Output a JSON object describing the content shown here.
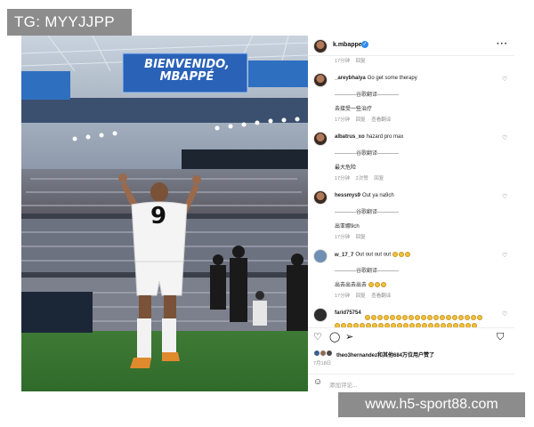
{
  "watermarks": {
    "top_left": "TG: MYYJJPP",
    "bottom_right": "www.h5-sport88.com"
  },
  "photo": {
    "banner_text_line1": "BIENVENIDO,",
    "banner_text_line2": "MBAPPÉ",
    "jersey_number": "9"
  },
  "post": {
    "username": "k.mbappe",
    "verified_icon": "✓",
    "more_label": "···",
    "comments": [
      {
        "user": "",
        "text": "",
        "translation_divider": "",
        "translation": "",
        "time": "17分钟",
        "likes": "",
        "reply": "回复",
        "see_translation": ""
      },
      {
        "user": "_areybhaiya",
        "text": "Go get some therapy",
        "translation_divider": "------------谷歌翻译------------",
        "translation": "去接受一些治疗",
        "time": "17分钟",
        "likes": "",
        "reply": "回复",
        "see_translation": "查看翻译"
      },
      {
        "user": "albatrus_xo",
        "text": "hazard pro max",
        "translation_divider": "------------谷歌翻译------------",
        "translation": "最大危险",
        "time": "17分钟",
        "likes": "2次赞",
        "reply": "回复",
        "see_translation": ""
      },
      {
        "user": "hessmys9",
        "text": "Out ya na9ch",
        "translation_divider": "------------谷歌翻译------------",
        "translation": "出亚娜9ch",
        "time": "17分钟",
        "likes": "",
        "reply": "回复",
        "see_translation": ""
      },
      {
        "user": "w_17_7",
        "text": "Out out out out",
        "translation_divider": "------------谷歌翻译------------",
        "translation": "出去出去出去",
        "time": "17分钟",
        "likes": "",
        "reply": "回复",
        "see_translation": "查看翻译"
      },
      {
        "user": "farid75754",
        "text": "",
        "translation_divider": "",
        "translation": "",
        "time": "",
        "likes": "",
        "reply": "",
        "see_translation": ""
      }
    ],
    "likes_text": "theo3hernandez和其他684万位用户赞了",
    "date": "7月18日",
    "add_comment_placeholder": "添加评论...",
    "icons": {
      "like": "heart-icon",
      "comment": "comment-icon",
      "share": "share-icon",
      "save": "bookmark-icon",
      "emoji": "smile-icon",
      "more": "more-icon"
    }
  }
}
